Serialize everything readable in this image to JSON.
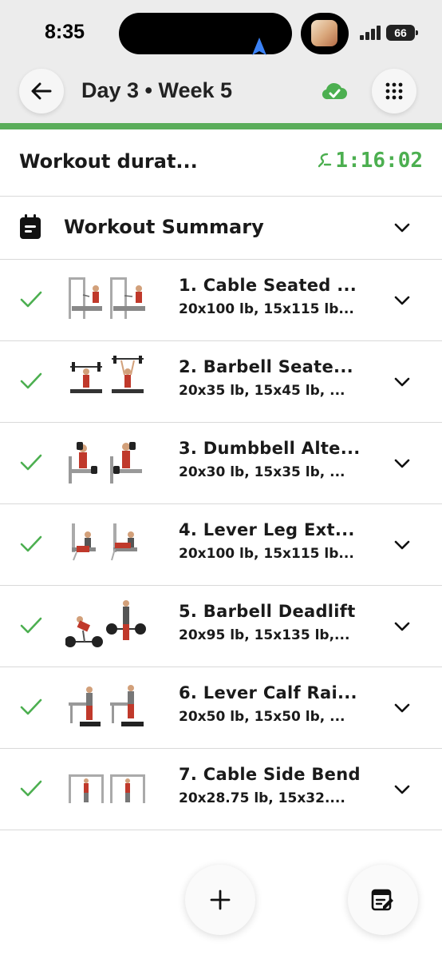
{
  "status_bar": {
    "time": "8:35",
    "battery": "66"
  },
  "header": {
    "title": "Day 3 • Week 5"
  },
  "duration": {
    "label": "Workout durat...",
    "timer": "1:16:02"
  },
  "summary": {
    "title": "Workout Summary"
  },
  "exercises": [
    {
      "name": "1. Cable Seated ...",
      "sets": "20x100 lb, 15x115 lb..."
    },
    {
      "name": "2. Barbell Seate...",
      "sets": "20x35 lb, 15x45 lb, ..."
    },
    {
      "name": "3. Dumbbell Alte...",
      "sets": "20x30 lb, 15x35 lb, ..."
    },
    {
      "name": "4. Lever Leg Ext...",
      "sets": "20x100 lb, 15x115 lb..."
    },
    {
      "name": "5. Barbell Deadlift",
      "sets": "20x95 lb, 15x135 lb,..."
    },
    {
      "name": "6. Lever Calf Rai...",
      "sets": "20x50 lb, 15x50 lb, ..."
    },
    {
      "name": "7. Cable Side Bend",
      "sets": "20x28.75 lb, 15x32...."
    }
  ],
  "colors": {
    "accent": "#5aad5a",
    "timer": "#4caf50",
    "header_bg": "#ececec"
  },
  "icons": {
    "back": "arrow-left-icon",
    "cloud": "cloud-check-icon",
    "menu": "grid-dots-icon",
    "summary": "clipboard-icon",
    "add": "plus-icon",
    "notes": "edit-notes-icon"
  }
}
